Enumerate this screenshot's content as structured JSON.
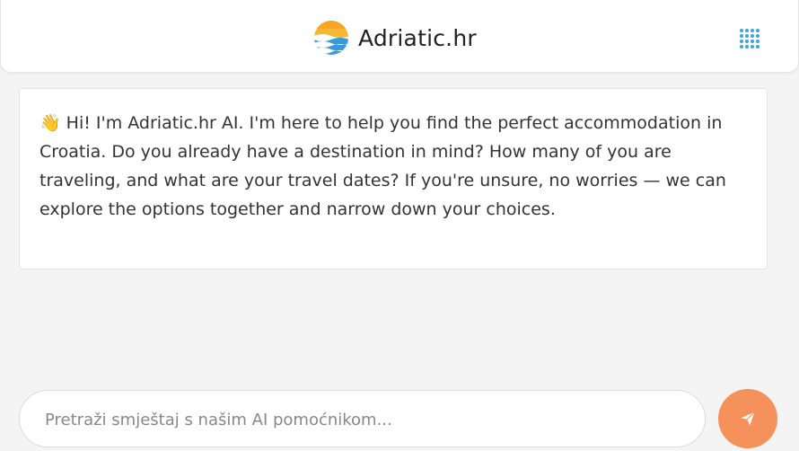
{
  "header": {
    "brand_name": "Adriatic.hr",
    "logo_icon": "sun-over-sea-logo",
    "apps_icon": "grid-dots-icon"
  },
  "chat": {
    "messages": [
      {
        "role": "assistant",
        "emoji": "👋",
        "text": "Hi! I'm Adriatic.hr AI. I'm here to help you find the perfect accommodation in Croatia. Do you already have a destination in mind? How many of you are traveling, and what are your travel dates? If you're unsure, no worries — we can explore the options together and narrow down your choices."
      }
    ]
  },
  "composer": {
    "placeholder": "Pretraži smještaj s našim AI pomoćnikom...",
    "value": "",
    "send_icon": "paper-plane-icon"
  },
  "colors": {
    "accent": "#f5915a",
    "apps_icon": "#3aa5d8",
    "background": "#f4f4f4"
  }
}
